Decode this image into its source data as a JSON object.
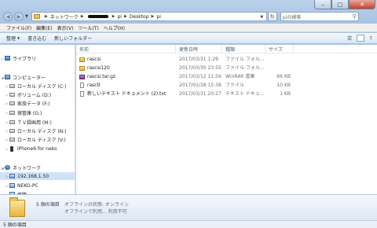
{
  "address": {
    "crumbs": [
      "ネットワーク",
      "pi",
      "Desktop",
      "pi"
    ]
  },
  "search": {
    "placeholder": "piの検索"
  },
  "menu": [
    "ファイル(F)",
    "編集(E)",
    "表示(V)",
    "ツール(T)",
    "ヘルプ(H)"
  ],
  "commands": {
    "organize": "整理",
    "burn": "書き込む",
    "new_folder": "新しいフォルダー"
  },
  "nav": {
    "libraries": "ライブラリ",
    "computer": "コンピューター",
    "drives": [
      "ローカル ディスク (C:)",
      "ボリューム (D:)",
      "家族データ (F:)",
      "保管庫 (G:)",
      "ＴＶ録画用 (M:)",
      "ローカル ディスク (N:)",
      "ローカル ディスク (V:)",
      "iPhone6 for neko"
    ],
    "network": "ネットワーク",
    "hosts": [
      "192.168.1.50",
      "NEKO-PC",
      "備騰"
    ]
  },
  "columns": {
    "name": "名前",
    "date": "更新日時",
    "type": "種類",
    "size": "サイズ"
  },
  "files": [
    {
      "name": "rascsi",
      "date": "2017/03/31 1:29",
      "type": "ファイル フォル...",
      "size": "",
      "icon": "folder-icon"
    },
    {
      "name": "rascsi120",
      "date": "2017/03/30 23:55",
      "type": "ファイル フォル...",
      "size": "",
      "icon": "folder-icon"
    },
    {
      "name": "rascsi.tar.gz",
      "date": "2017/03/12 11:56",
      "type": "WinRAR 書庫",
      "size": "66 KB",
      "icon": "archive-icon"
    },
    {
      "name": "rasctl",
      "date": "2017/01/28 15:38",
      "type": "ファイル",
      "size": "10 KB",
      "icon": "file-icon"
    },
    {
      "name": "新しいテキスト ドキュメント (2).txt",
      "date": "2017/03/31 20:27",
      "type": "テキスト ドキュ...",
      "size": "1 KB",
      "icon": "text-file-icon"
    }
  ],
  "details": {
    "count": "5 個の項目",
    "offline_status": "オフラインの状態: オンライン",
    "offline_avail": "オフラインで利用... 利用不可"
  },
  "status": {
    "count": "5 個の項目"
  }
}
